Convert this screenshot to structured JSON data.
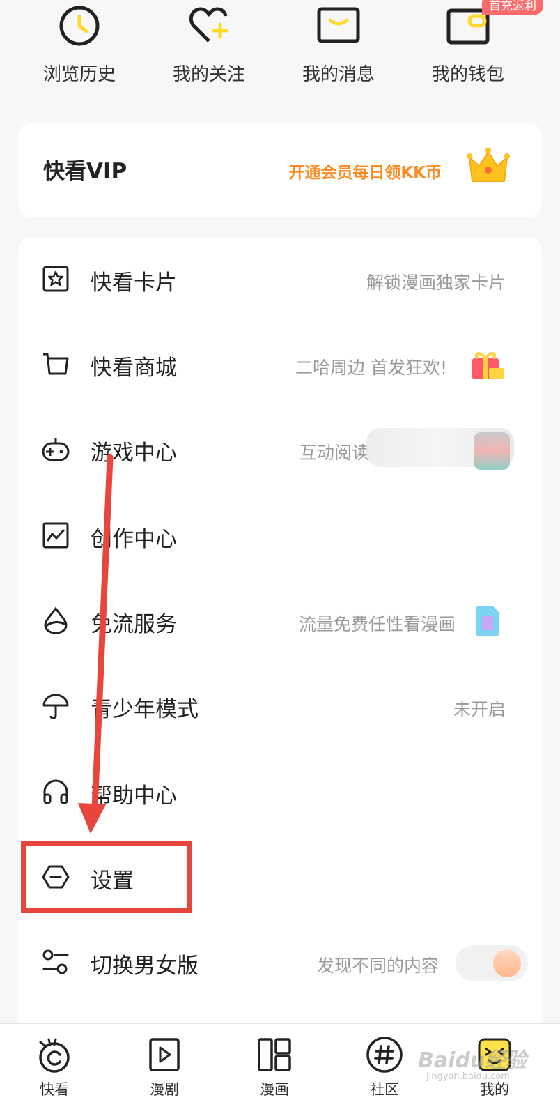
{
  "quick_actions": [
    {
      "label": "浏览历史",
      "icon": "clock-icon"
    },
    {
      "label": "我的关注",
      "icon": "heart-plus-icon"
    },
    {
      "label": "我的消息",
      "icon": "message-icon"
    },
    {
      "label": "我的钱包",
      "icon": "wallet-icon",
      "badge": "首充返利"
    }
  ],
  "vip": {
    "title": "快看VIP",
    "promo": "开通会员每日领KK币",
    "icon": "crown-icon"
  },
  "menu": [
    {
      "label": "快看卡片",
      "hint": "解锁漫画独家卡片",
      "icon": "card-star-icon"
    },
    {
      "label": "快看商城",
      "hint": "二哈周边 首发狂欢!",
      "icon": "cart-icon"
    },
    {
      "label": "游戏中心",
      "hint": "互动阅读",
      "icon": "gamepad-icon"
    },
    {
      "label": "创作中心",
      "hint": "",
      "icon": "chart-icon"
    },
    {
      "label": "免流服务",
      "hint": "流量免费任性看漫画",
      "icon": "drop-icon"
    },
    {
      "label": "青少年模式",
      "hint": "未开启",
      "icon": "umbrella-icon"
    },
    {
      "label": "帮助中心",
      "hint": "",
      "icon": "headphones-icon"
    },
    {
      "label": "设置",
      "hint": "",
      "icon": "settings-icon"
    },
    {
      "label": "切换男女版",
      "hint": "发现不同的内容",
      "icon": "switch-icon"
    }
  ],
  "bottom_nav": [
    {
      "label": "快看",
      "icon": "kuaikan-eye-icon"
    },
    {
      "label": "漫剧",
      "icon": "play-icon"
    },
    {
      "label": "漫画",
      "icon": "comic-grid-icon"
    },
    {
      "label": "社区",
      "icon": "hashtag-icon"
    },
    {
      "label": "我的",
      "icon": "profile-face-icon"
    }
  ],
  "watermark": {
    "brand": "Baidu经验",
    "sub": "jingyan.baidu.com"
  },
  "colors": {
    "accent_orange": "#ff8a1f",
    "annotation_red": "#e8453c",
    "brand_yellow": "#ffe24a"
  }
}
